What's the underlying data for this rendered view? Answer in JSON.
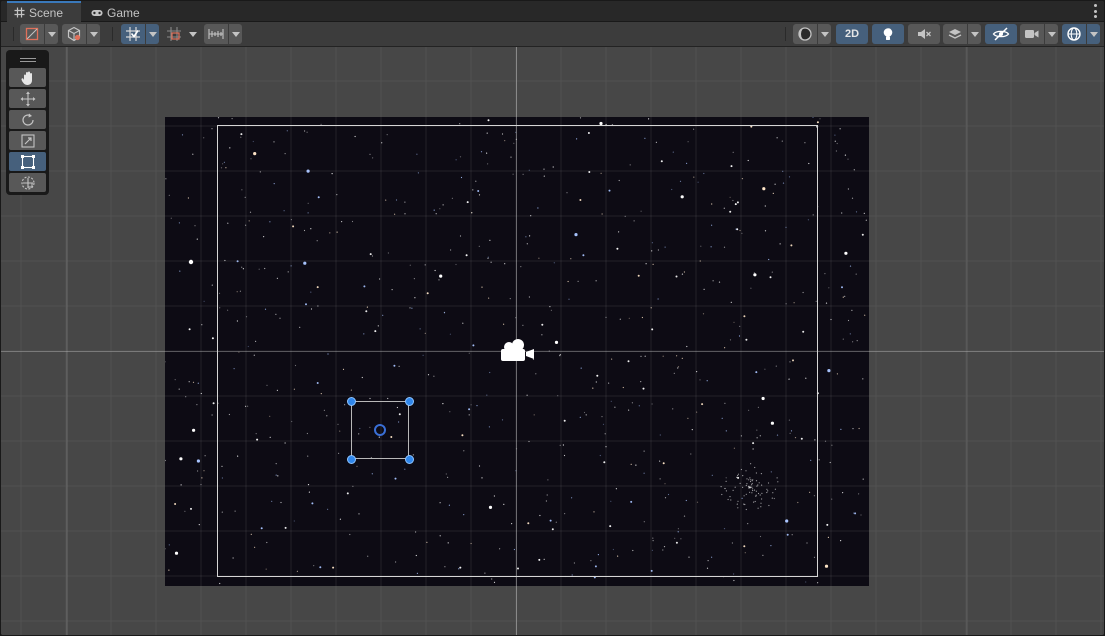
{
  "tabs": [
    {
      "label": "Scene",
      "icon": "grid-hash-icon",
      "active": true
    },
    {
      "label": "Game",
      "icon": "gamepad-icon",
      "active": false
    }
  ],
  "toolbar": {
    "left": [
      {
        "name": "gizmo-draw-mode",
        "icon": "wireframe-icon",
        "has_dropdown": true
      },
      {
        "name": "scene-camera-mode",
        "icon": "cube-icon",
        "has_dropdown": true
      },
      {
        "name": "grid-snapping",
        "icon": "grid-snap-icon",
        "has_dropdown": true,
        "active": true
      },
      {
        "name": "increment-snap",
        "icon": "increment-snap-icon",
        "has_dropdown": true
      },
      {
        "name": "ruler",
        "icon": "ruler-icon",
        "has_dropdown": true
      }
    ],
    "right": [
      {
        "name": "shading-mode",
        "icon": "sphere-shading-icon",
        "has_dropdown": true
      },
      {
        "name": "2d-toggle",
        "label": "2D",
        "active": true
      },
      {
        "name": "lighting-toggle",
        "icon": "lightbulb-icon",
        "active": true
      },
      {
        "name": "audio-toggle",
        "icon": "mute-icon"
      },
      {
        "name": "effects-toggle",
        "icon": "layers-icon",
        "has_dropdown": true
      },
      {
        "name": "visibility-toggle",
        "icon": "hidden-eye-icon",
        "active": true
      },
      {
        "name": "scene-camera",
        "icon": "video-camera-icon",
        "has_dropdown": true
      },
      {
        "name": "gizmos",
        "icon": "gizmo-globe-icon",
        "has_dropdown": true,
        "active": true
      }
    ]
  },
  "tools": [
    {
      "name": "view-tool",
      "icon": "hand-icon"
    },
    {
      "name": "move-tool",
      "icon": "move-arrows-icon"
    },
    {
      "name": "rotate-tool",
      "icon": "rotate-icon"
    },
    {
      "name": "scale-tool",
      "icon": "scale-icon"
    },
    {
      "name": "rect-tool",
      "icon": "rect-transform-icon",
      "active": true
    },
    {
      "name": "transform-tool",
      "icon": "transform-icon"
    }
  ],
  "colors": {
    "accent": "#3a79bb",
    "active_button": "#46607c",
    "handle": "#2f86ea",
    "viewport": "#474747",
    "space": "#0d0b14"
  }
}
